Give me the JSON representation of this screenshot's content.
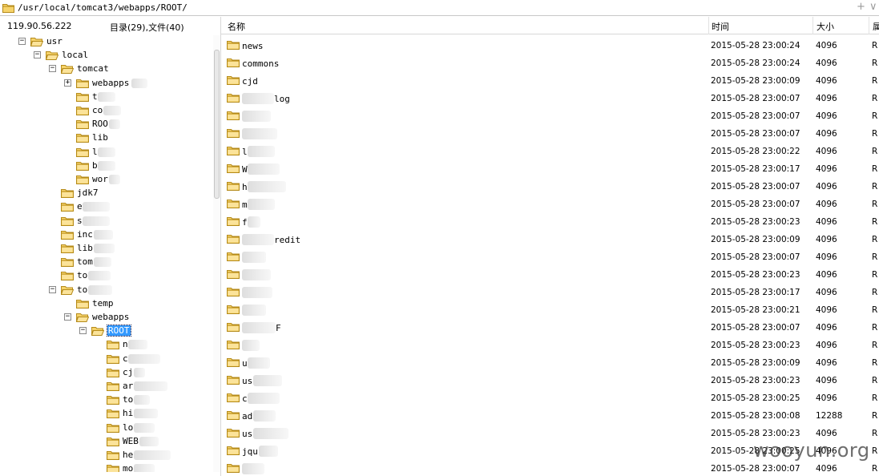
{
  "path_bar": {
    "path": "/usr/local/tomcat3/webapps/ROOT/",
    "ctrl_add": "+",
    "ctrl_menu": "∨"
  },
  "left_header": {
    "ip": "119.90.56.222",
    "counts": "目录(29),文件(40)"
  },
  "columns": {
    "name": "名称",
    "time": "时间",
    "size": "大小",
    "attr": "属"
  },
  "tree": [
    {
      "level": 1,
      "exp": "−",
      "label": "usr",
      "blur": 0,
      "selected": false
    },
    {
      "level": 2,
      "exp": "−",
      "label": "local",
      "blur": 0,
      "selected": false
    },
    {
      "level": 3,
      "exp": "−",
      "label": "tomcat",
      "blur": 0,
      "selected": false
    },
    {
      "level": 4,
      "exp": "+",
      "label": "webapps",
      "blur": 20,
      "selected": false
    },
    {
      "level": 4,
      "exp": "",
      "label": "t",
      "blur": 22,
      "selected": false
    },
    {
      "level": 4,
      "exp": "",
      "label": "co",
      "blur": 22,
      "selected": false
    },
    {
      "level": 4,
      "exp": "",
      "label": "ROO",
      "blur": 14,
      "selected": false
    },
    {
      "level": 4,
      "exp": "",
      "label": "lib",
      "blur": 0,
      "selected": false
    },
    {
      "level": 4,
      "exp": "",
      "label": "l",
      "blur": 22,
      "selected": false
    },
    {
      "level": 4,
      "exp": "",
      "label": "b",
      "blur": 22,
      "selected": false
    },
    {
      "level": 4,
      "exp": "",
      "label": "wor",
      "blur": 14,
      "selected": false
    },
    {
      "level": 3,
      "exp": "",
      "label": "jdk7",
      "blur": 0,
      "selected": false
    },
    {
      "level": 3,
      "exp": "",
      "label": "e",
      "blur": 34,
      "selected": false
    },
    {
      "level": 3,
      "exp": "",
      "label": "s",
      "blur": 34,
      "selected": false
    },
    {
      "level": 3,
      "exp": "",
      "label": "inc",
      "blur": 24,
      "selected": false
    },
    {
      "level": 3,
      "exp": "",
      "label": "lib",
      "blur": 26,
      "selected": false
    },
    {
      "level": 3,
      "exp": "",
      "label": "tom",
      "blur": 22,
      "selected": false
    },
    {
      "level": 3,
      "exp": "",
      "label": "to",
      "blur": 28,
      "selected": false
    },
    {
      "level": 3,
      "exp": "−",
      "label": "to",
      "blur": 30,
      "selected": false
    },
    {
      "level": 4,
      "exp": "",
      "label": "temp",
      "blur": 0,
      "selected": false
    },
    {
      "level": 4,
      "exp": "−",
      "label": "webapps",
      "blur": 0,
      "selected": false
    },
    {
      "level": 5,
      "exp": "−",
      "label": "ROOT",
      "blur": 0,
      "selected": true
    },
    {
      "level": 6,
      "exp": "",
      "label": "n",
      "blur": 24,
      "selected": false
    },
    {
      "level": 6,
      "exp": "",
      "label": "c",
      "blur": 40,
      "selected": false
    },
    {
      "level": 6,
      "exp": "",
      "label": "cj",
      "blur": 14,
      "selected": false
    },
    {
      "level": 6,
      "exp": "",
      "label": "ar",
      "blur": 42,
      "selected": false
    },
    {
      "level": 6,
      "exp": "",
      "label": "to",
      "blur": 20,
      "selected": false
    },
    {
      "level": 6,
      "exp": "",
      "label": "hi",
      "blur": 30,
      "selected": false
    },
    {
      "level": 6,
      "exp": "",
      "label": "lo",
      "blur": 26,
      "selected": false
    },
    {
      "level": 6,
      "exp": "",
      "label": "WEB",
      "blur": 24,
      "selected": false
    },
    {
      "level": 6,
      "exp": "",
      "label": "he",
      "blur": 46,
      "selected": false
    },
    {
      "level": 6,
      "exp": "",
      "label": "mo",
      "blur": 26,
      "selected": false
    }
  ],
  "files": [
    {
      "name": "news",
      "blur": 0,
      "time": "2015-05-28 23:00:24",
      "size": "4096",
      "attr": "R"
    },
    {
      "name": "commons",
      "blur": 0,
      "time": "2015-05-28 23:00:24",
      "size": "4096",
      "attr": "R"
    },
    {
      "name": "cjd",
      "blur": 0,
      "time": "2015-05-28 23:00:09",
      "size": "4096",
      "attr": "R"
    },
    {
      "name": "log",
      "blur": 40,
      "time": "2015-05-28 23:00:07",
      "size": "4096",
      "attr": "R"
    },
    {
      "name": "",
      "blur": 36,
      "time": "2015-05-28 23:00:07",
      "size": "4096",
      "attr": "R"
    },
    {
      "name": "",
      "blur": 44,
      "time": "2015-05-28 23:00:07",
      "size": "4096",
      "attr": "R"
    },
    {
      "name": "l",
      "blur": 34,
      "time": "2015-05-28 23:00:22",
      "size": "4096",
      "attr": "R"
    },
    {
      "name": "W",
      "blur": 40,
      "time": "2015-05-28 23:00:17",
      "size": "4096",
      "attr": "R"
    },
    {
      "name": "h",
      "blur": 48,
      "time": "2015-05-28 23:00:07",
      "size": "4096",
      "attr": "R"
    },
    {
      "name": "m",
      "blur": 34,
      "time": "2015-05-28 23:00:07",
      "size": "4096",
      "attr": "R"
    },
    {
      "name": "f",
      "blur": 16,
      "time": "2015-05-28 23:00:23",
      "size": "4096",
      "attr": "R"
    },
    {
      "name": "redit",
      "blur": 40,
      "time": "2015-05-28 23:00:09",
      "size": "4096",
      "attr": "R"
    },
    {
      "name": "",
      "blur": 30,
      "time": "2015-05-28 23:00:07",
      "size": "4096",
      "attr": "R"
    },
    {
      "name": "",
      "blur": 36,
      "time": "2015-05-28 23:00:23",
      "size": "4096",
      "attr": "R"
    },
    {
      "name": "",
      "blur": 38,
      "time": "2015-05-28 23:00:17",
      "size": "4096",
      "attr": "R"
    },
    {
      "name": "",
      "blur": 30,
      "time": "2015-05-28 23:00:21",
      "size": "4096",
      "attr": "R"
    },
    {
      "name": "F",
      "blur": 42,
      "time": "2015-05-28 23:00:07",
      "size": "4096",
      "attr": "R"
    },
    {
      "name": "",
      "blur": 22,
      "time": "2015-05-28 23:00:23",
      "size": "4096",
      "attr": "R"
    },
    {
      "name": "u",
      "blur": 28,
      "time": "2015-05-28 23:00:09",
      "size": "4096",
      "attr": "R"
    },
    {
      "name": "us",
      "blur": 36,
      "time": "2015-05-28 23:00:23",
      "size": "4096",
      "attr": "R"
    },
    {
      "name": "c",
      "blur": 40,
      "time": "2015-05-28 23:00:25",
      "size": "4096",
      "attr": "R"
    },
    {
      "name": "ad",
      "blur": 28,
      "time": "2015-05-28 23:00:08",
      "size": "12288",
      "attr": "R"
    },
    {
      "name": "us",
      "blur": 44,
      "time": "2015-05-28 23:00:23",
      "size": "4096",
      "attr": "R"
    },
    {
      "name": "jqu",
      "blur": 24,
      "time": "2015-05-28 23:00:25",
      "size": "4096",
      "attr": "R"
    },
    {
      "name": "",
      "blur": 28,
      "time": "2015-05-28 23:00:07",
      "size": "4096",
      "attr": "R"
    }
  ],
  "watermark": "wooyun.org",
  "colors": {
    "selection": "#3399ff",
    "folder": "#f2c94c",
    "folder_stroke": "#b48a1a"
  }
}
